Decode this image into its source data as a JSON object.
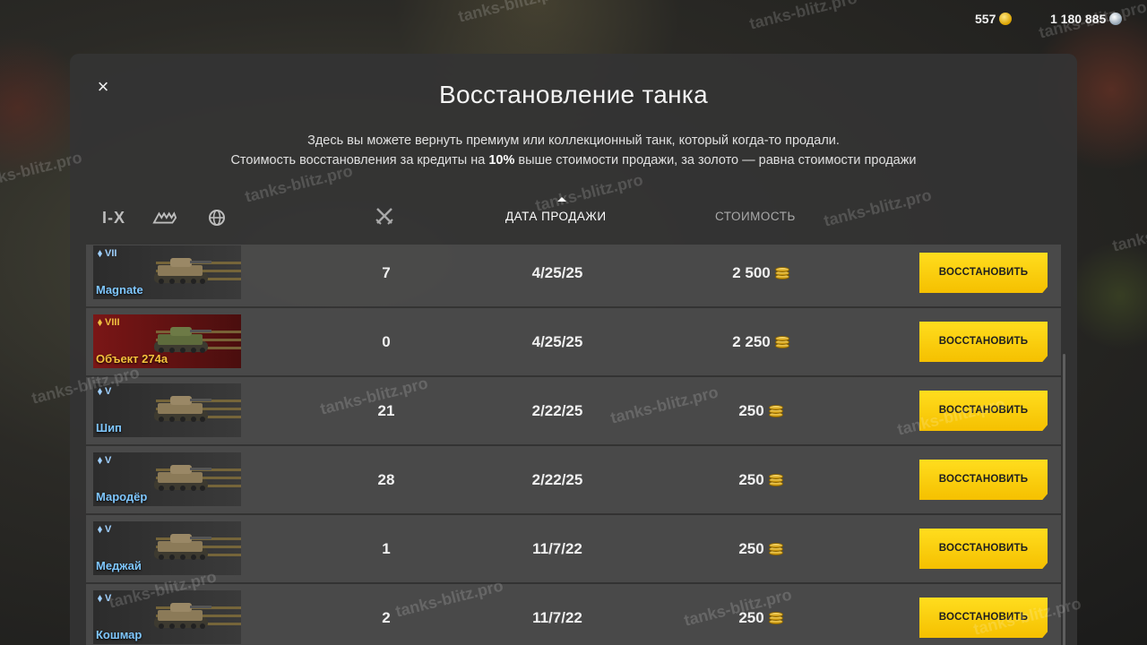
{
  "currency": {
    "gold": "557",
    "credits": "1 180 885"
  },
  "dialog": {
    "title": "Восстановление танка",
    "desc_line1": "Здесь вы можете вернуть премиум или коллекционный танк, который когда-то продали.",
    "desc_line2_a": "Стоимость восстановления за кредиты на ",
    "desc_line2_bold": "10%",
    "desc_line2_b": " выше стоимости продажи, за золото — равна стоимости продажи",
    "close_label": "×"
  },
  "filters": {
    "tier_label": "I-X"
  },
  "columns": {
    "date": "ДАТА ПРОДАЖИ",
    "price": "СТОИМОСТЬ"
  },
  "restore_label": "ВОССТАНОВИТЬ",
  "rows": [
    {
      "tier": "VII",
      "name": "Magnate",
      "battles": "7",
      "date": "4/25/25",
      "price": "2 500",
      "nation": "other"
    },
    {
      "tier": "VIII",
      "name": "Объект 274а",
      "battles": "0",
      "date": "4/25/25",
      "price": "2 250",
      "nation": "soviet"
    },
    {
      "tier": "V",
      "name": "Шип",
      "battles": "21",
      "date": "2/22/25",
      "price": "250",
      "nation": "other"
    },
    {
      "tier": "V",
      "name": "Мародёр",
      "battles": "28",
      "date": "2/22/25",
      "price": "250",
      "nation": "other"
    },
    {
      "tier": "V",
      "name": "Меджай",
      "battles": "1",
      "date": "11/7/22",
      "price": "250",
      "nation": "other"
    },
    {
      "tier": "V",
      "name": "Кошмар",
      "battles": "2",
      "date": "11/7/22",
      "price": "250",
      "nation": "other"
    }
  ],
  "watermark": "tanks-blitz.pro",
  "colors": {
    "accent_button": "#f5c000",
    "premium_name": "#7fc7ff",
    "collector_name": "#f7c23c"
  }
}
